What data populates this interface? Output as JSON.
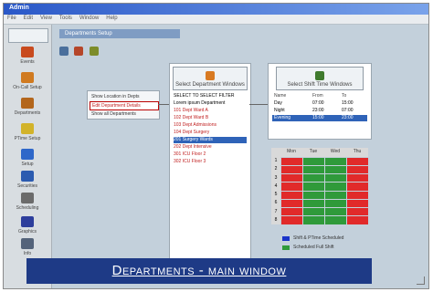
{
  "window": {
    "title": "Admin"
  },
  "menu": [
    "File",
    "Edit",
    "View",
    "Tools",
    "Window",
    "Help"
  ],
  "sidebar": {
    "items": [
      {
        "label": "Events",
        "icon": "calendar-icon",
        "color": "#c84a1e"
      },
      {
        "label": "On-Call Setup",
        "icon": "phone-icon",
        "color": "#d07a20"
      },
      {
        "label": "Departments",
        "icon": "people-icon",
        "color": "#b3661c"
      },
      {
        "label": "PTime Setup",
        "icon": "star-icon",
        "color": "#d2b32a"
      },
      {
        "label": "Setup",
        "icon": "user-icon",
        "color": "#2e67c9"
      },
      {
        "label": "Securities",
        "icon": "floppy-icon",
        "color": "#2b5bb0"
      },
      {
        "label": "Scheduling",
        "icon": "clock-icon",
        "color": "#6b6b6b"
      },
      {
        "label": "Graphics",
        "icon": "doc-icon",
        "color": "#2d3e9c"
      },
      {
        "label": "Info",
        "icon": "info-icon",
        "color": "#54637a"
      }
    ]
  },
  "main": {
    "tab": "Departments Setup",
    "toolbar_icons": [
      "save-icon",
      "add-icon",
      "delete-icon"
    ]
  },
  "context_menu": {
    "items": [
      "Show Location in Depts",
      "Edit Department Details",
      "Show all Departments"
    ]
  },
  "departments_panel": {
    "button_label": "Select Department Windows",
    "rows": [
      {
        "text": "SELECT TO SELECT FILTER",
        "style": "normal"
      },
      {
        "text": "Lorem ipsum Department",
        "style": "normal"
      },
      {
        "text": "101 Dept Ward A",
        "style": "red"
      },
      {
        "text": "102 Dept Ward B",
        "style": "red"
      },
      {
        "text": "103 Dept Admissions",
        "style": "red"
      },
      {
        "text": "104 Dept Surgery",
        "style": "red"
      },
      {
        "text": "201 Surgery Wards",
        "style": "selected"
      },
      {
        "text": "202 Dept Intensive",
        "style": "red"
      },
      {
        "text": "301 ICU Floor 2",
        "style": "red"
      },
      {
        "text": "302 ICU Floor 3",
        "style": "red"
      }
    ]
  },
  "shifts_panel": {
    "button_label": "Select Shift Time Windows",
    "headers": [
      "Name",
      "From",
      "To"
    ],
    "rows": [
      {
        "cells": [
          "Day",
          "07:00",
          "15:00"
        ]
      },
      {
        "cells": [
          "Night",
          "23:00",
          "07:00"
        ]
      },
      {
        "cells": [
          "Evening",
          "15:00",
          "23:00"
        ],
        "selected": true
      }
    ]
  },
  "schedule_grid": {
    "columns": [
      "Mon",
      "Tue",
      "Wed",
      "Thu"
    ],
    "rows": [
      "1",
      "2",
      "3",
      "4",
      "5",
      "6",
      "7",
      "8"
    ],
    "colors": {
      "header": "#d9d9d9",
      "red": "#e12a2a",
      "green": "#2f9a3a"
    }
  },
  "legend": {
    "items": [
      {
        "label": "Shift & PTime Scheduled",
        "color": "#1a34c9"
      },
      {
        "label": "Scheduled Full Shift",
        "color": "#2f9a3a"
      }
    ]
  },
  "caption": {
    "text": "Departments - main window"
  }
}
